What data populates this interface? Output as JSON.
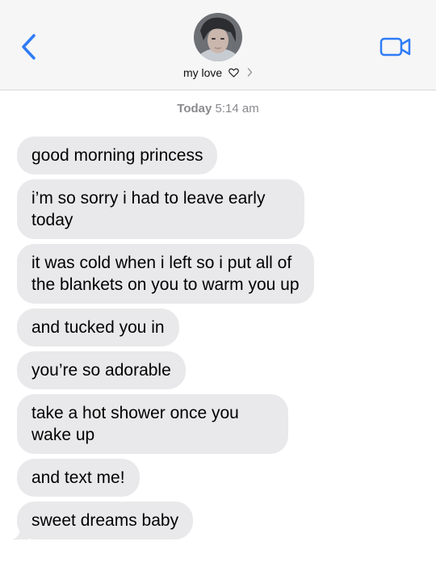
{
  "header": {
    "contact_name": "my love",
    "icons": {
      "back": "chevron-left-icon",
      "video": "video-camera-icon",
      "heart": "heart-outline-icon",
      "disclosure": "chevron-right-icon"
    },
    "accent_color": "#2f7cf6"
  },
  "timestamp": {
    "day": "Today",
    "time": "5:14 am"
  },
  "messages": [
    {
      "text": "good morning princess"
    },
    {
      "text": "i’m so sorry i had to leave early today"
    },
    {
      "text": "it was cold when i left so i put all of the blankets on you to warm you up"
    },
    {
      "text": "and tucked you in"
    },
    {
      "text": "you’re so adorable"
    },
    {
      "text": "take a hot shower once you wake up"
    },
    {
      "text": "and text me!"
    },
    {
      "text": "sweet dreams baby"
    }
  ],
  "colors": {
    "incoming_bubble": "#e9e9eb",
    "header_bg": "#f6f6f6",
    "timestamp": "#8a8a8e"
  }
}
